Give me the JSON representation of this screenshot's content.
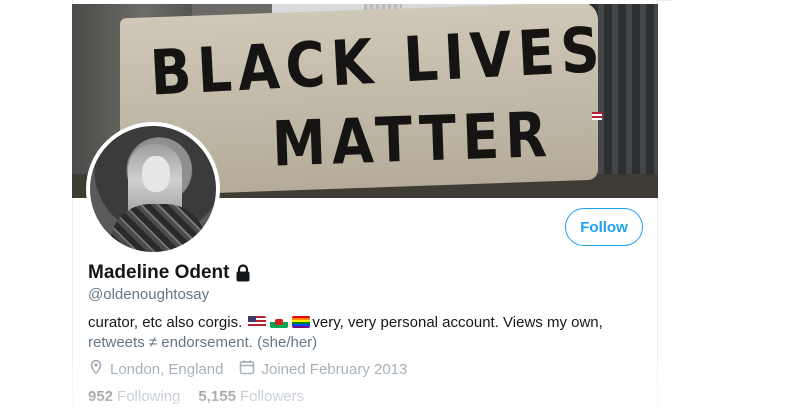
{
  "banner": {
    "line1": "BLACK LIVES",
    "line2": "MATTER"
  },
  "profile": {
    "name": "Madeline Odent",
    "handle": "@oldenoughtosay",
    "protected_icon": "lock-icon",
    "follow_label": "Follow",
    "bio_line1_prefix": "curator, etc also corgis.",
    "bio_line1_suffix": "very, very personal account. Views my own,",
    "bio_line2": "retweets ≠ endorsement. (she/her)",
    "bio_emojis": [
      "us-flag-icon",
      "wales-flag-icon",
      "rainbow-flag-icon"
    ],
    "location": "London, England",
    "joined": "Joined February 2013",
    "following_count": "952",
    "following_label": "Following",
    "followers_count": "5,155",
    "followers_label": "Followers"
  },
  "colors": {
    "accent": "#1da1f2",
    "secondary_text": "#657786",
    "primary_text": "#14171a"
  }
}
